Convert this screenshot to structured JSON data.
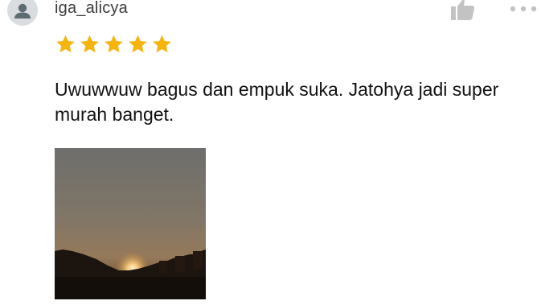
{
  "review": {
    "username": "iga_alicya",
    "rating": 5,
    "rating_max": 5,
    "text": "Uwuwwuw bagus dan empuk suka. Jatohya jadi super murah banget."
  },
  "icons": {
    "avatar": "person-icon",
    "like": "thumbs-up-icon",
    "more": "more-horizontal-icon",
    "star": "star-icon"
  },
  "colors": {
    "star": "#f6b40e",
    "username": "#3c3c3c",
    "text": "#111111",
    "icon_gray": "#c3c3c3"
  }
}
